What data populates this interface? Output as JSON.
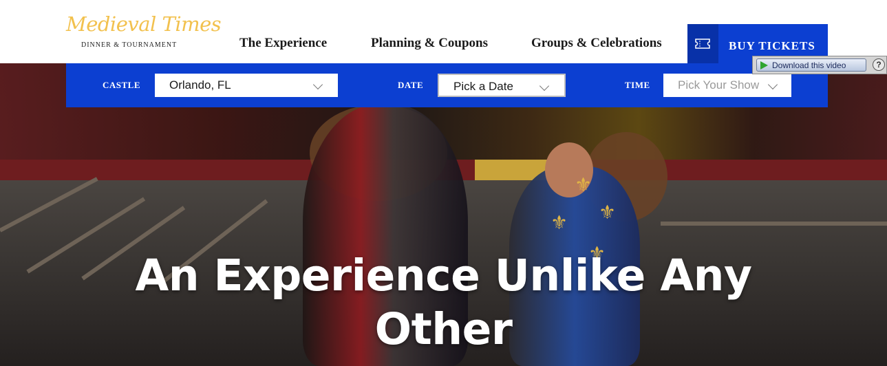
{
  "header": {
    "logo_script": "Medieval Times",
    "logo_sub": "DINNER & TOURNAMENT",
    "nav": [
      "The Experience",
      "Planning & Coupons",
      "Groups & Celebrations"
    ],
    "buy_tickets": "BUY TICKETS"
  },
  "booking": {
    "castle_label": "CASTLE",
    "castle_value": "Orlando, FL",
    "date_label": "DATE",
    "date_value": "Pick a Date",
    "time_label": "TIME",
    "time_placeholder": "Pick Your Show"
  },
  "download_widget": {
    "label": "Download this video",
    "help": "?"
  },
  "hero": {
    "headline_line1": "An Experience Unlike Any",
    "headline_line2": "Other"
  },
  "colors": {
    "brand_blue": "#0c3fd1",
    "logo_gold": "#f2c14e"
  }
}
